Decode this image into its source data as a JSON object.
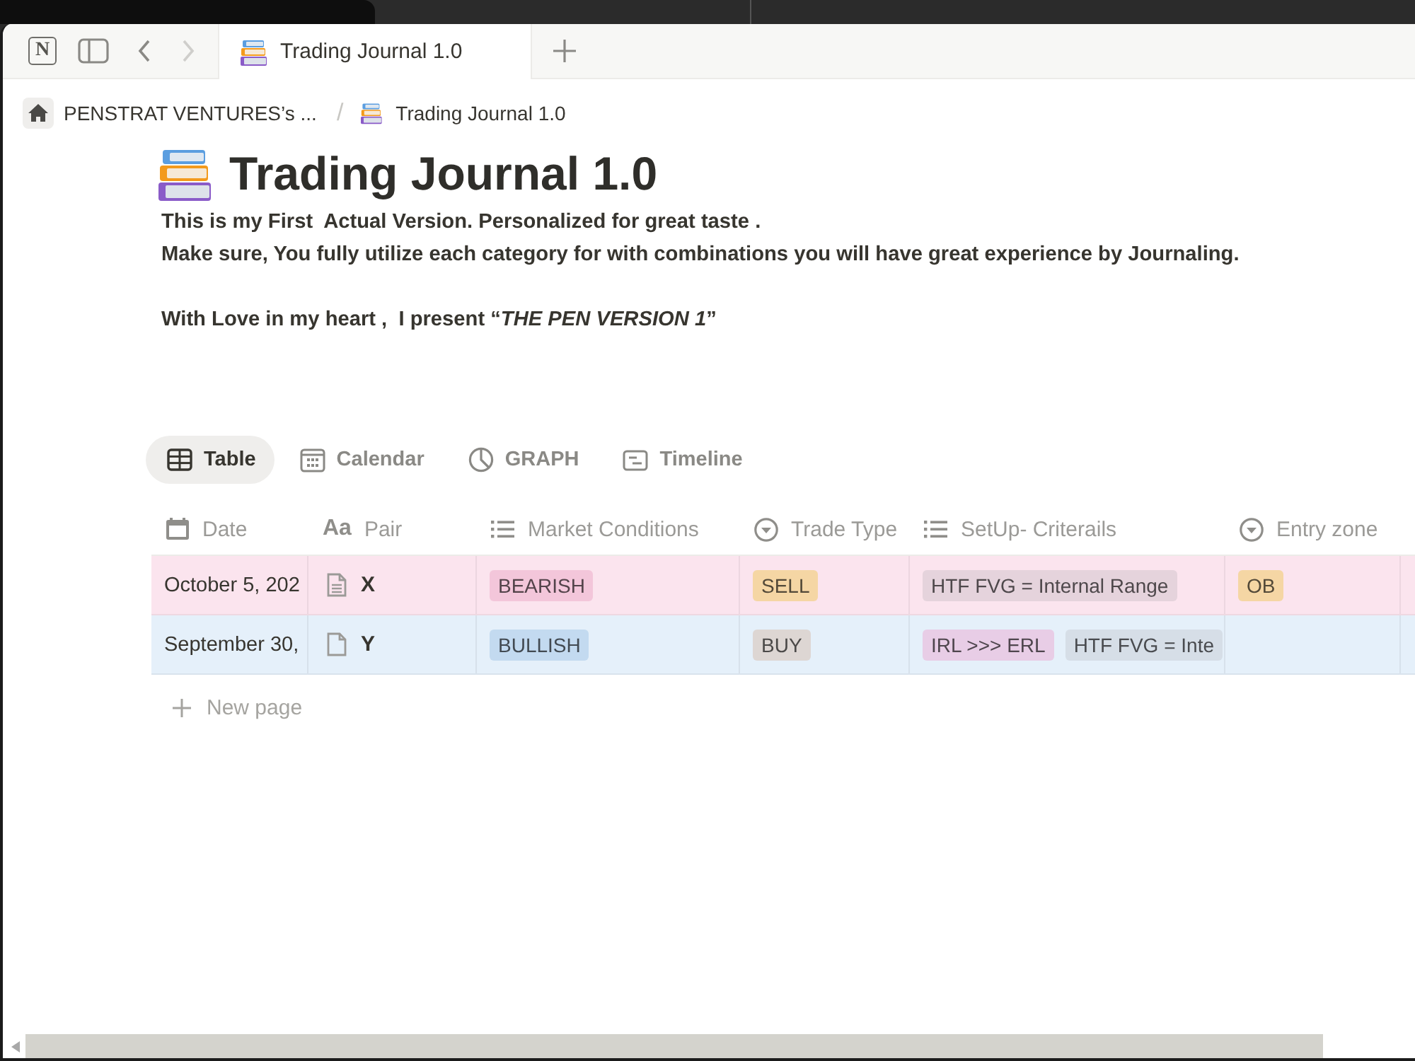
{
  "app_bar": {
    "logo": "N",
    "nav": [
      {
        "kind": "back",
        "disabled": false
      },
      {
        "kind": "forward",
        "disabled": true
      }
    ],
    "tab": {
      "title": "Trading Journal 1.0"
    }
  },
  "breadcrumb": {
    "separator": "/",
    "items": [
      {
        "kind": "workspace",
        "label": "PENSTRAT VENTURES’s ..."
      },
      {
        "kind": "page",
        "label": "Trading Journal 1.0"
      }
    ]
  },
  "page": {
    "title": "Trading Journal 1.0",
    "description": [
      [
        "This is my First  Actual Version. Personalized for great taste .",
        "Make sure, You fully utilize each category for with combinations you will have great experience by Journaling."
      ],
      [
        "With Love in my heart ,  I present “*THE PEN VERSION 1*”"
      ]
    ]
  },
  "views": [
    {
      "kind": "table",
      "label": "Table",
      "selected": true
    },
    {
      "kind": "calendar",
      "label": "Calendar",
      "selected": false
    },
    {
      "kind": "chart",
      "label": "GRAPH",
      "selected": false
    },
    {
      "kind": "timeline",
      "label": "Timeline",
      "selected": false
    }
  ],
  "table": {
    "columns": [
      {
        "kind": "date",
        "label": "Date"
      },
      {
        "kind": "title",
        "label": "Pair",
        "icon_label": "Aa"
      },
      {
        "kind": "multi_select",
        "label": "Market Conditions"
      },
      {
        "kind": "select",
        "label": "Trade Type"
      },
      {
        "kind": "multi_select",
        "label": "SetUp- Criterails"
      },
      {
        "kind": "select",
        "label": "Entry zone"
      }
    ],
    "rows": [
      {
        "color": "#fbe4ee",
        "cells": [
          {
            "text": "October 5, 202"
          },
          {
            "text": "X",
            "has_content": true
          },
          {
            "tags": [
              {
                "label": "BEARISH",
                "color": "#f3c6da"
              }
            ]
          },
          {
            "tags": [
              {
                "label": "SELL",
                "color": "#f5d6a4"
              }
            ]
          },
          {
            "tags": [
              {
                "label": "HTF FVG = Internal Range",
                "color": "#e5d3dc"
              }
            ]
          },
          {
            "tags": [
              {
                "label": "OB",
                "color": "#f5d6a4"
              }
            ]
          }
        ]
      },
      {
        "color": "#e5f0fa",
        "cells": [
          {
            "text": "September 30,"
          },
          {
            "text": "Y",
            "has_content": false
          },
          {
            "tags": [
              {
                "label": "BULLISH",
                "color": "#c3daf0"
              }
            ]
          },
          {
            "tags": [
              {
                "label": "BUY",
                "color": "#ddd6d3"
              }
            ]
          },
          {
            "tags": [
              {
                "label": "IRL >>> ERL",
                "color": "#e8cde6"
              },
              {
                "label": "HTF FVG = Inte",
                "color": "#d6dee7"
              }
            ]
          },
          {}
        ]
      }
    ],
    "new_row": {
      "label": "New page"
    }
  }
}
